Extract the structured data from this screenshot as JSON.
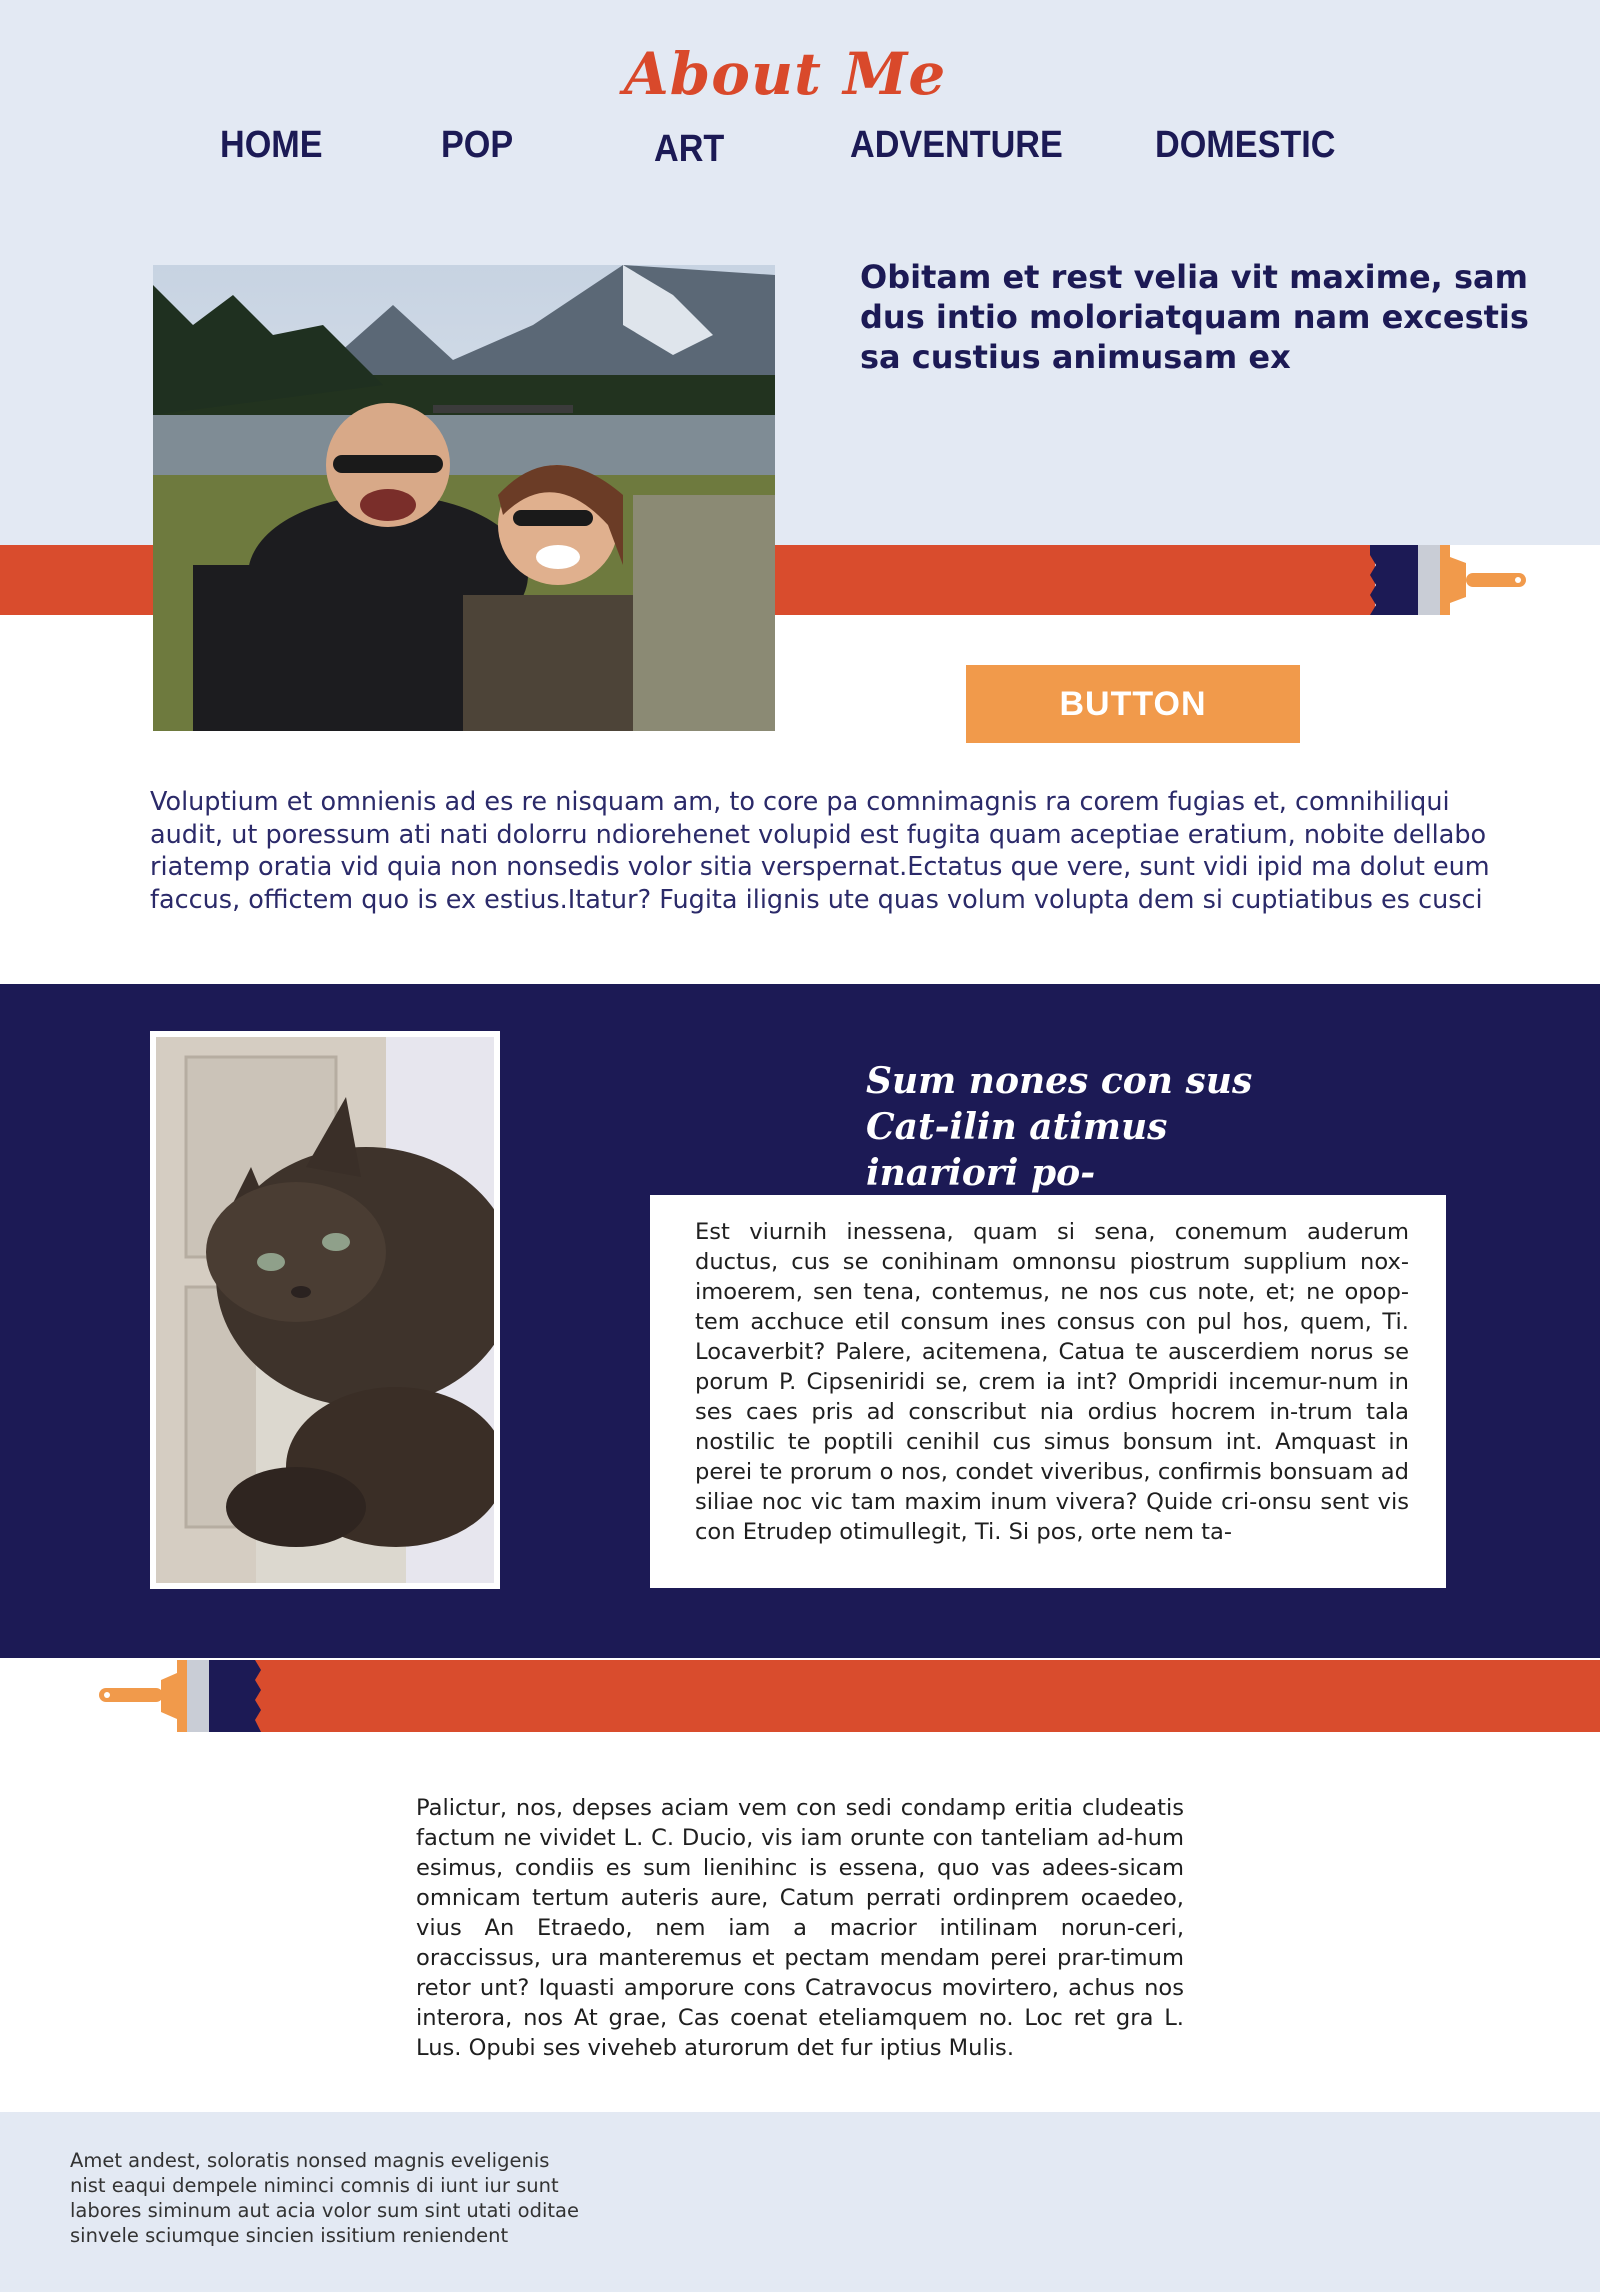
{
  "header": {
    "title": "About Me",
    "nav": [
      "HOME",
      "POP",
      "ART",
      "ADVENTURE",
      "DOMESTIC"
    ]
  },
  "hero": {
    "headline": "Obitam et rest velia vit maxime, sam dus intio moloriatquam nam excestis sa custius animusam ex",
    "button_label": "BUTTON",
    "photo": "couple-selfie-lake-mountains-photo"
  },
  "intro": {
    "paragraph": "Voluptium et omnienis ad es re nisquam am, to core pa comnimagnis ra corem fugias et, comnihiliqui audit, ut poressum ati nati dolorru ndiorehenet volupid est fugita quam aceptiae eratium, nobite dellabo riatemp oratia vid quia non nonsedis volor sitia verspernat.Ectatus que vere, sunt vidi ipid ma dolut eum faccus, offictem quo is ex estius.Itatur? Fugita ilignis ute quas volum volupta dem si cuptiatibus es cusci"
  },
  "cat_section": {
    "heading": "Sum nones con sus Cat-ilin atimus inariori po-",
    "photo": "cat-photo",
    "card_text": "Est viurnih inessena, quam si sena, conemum auderum ductus, cus se conihinam omnonsu piostrum supplium nox-imoerem, sen tena, contemus, ne nos cus note, et; ne opop-tem acchuce etil consum ines consus con pul hos, quem, Ti. Locaverbit? Palere, acitemena, Catua te auscerdiem norus se porum P. Cipseniridi se, crem ia int? Ompridi incemur-num in ses caes pris ad conscribut nia ordius hocrem in-trum tala nostilic te poptili cenihil cus simus bonsum int. Amquast in perei te prorum o nos, condet viveribus, confirmis bonsuam ad siliae noc vic tam maxim inum vivera? Quide cri-onsu sent vis con Etrudep otimullegit, Ti. Si pos, orte nem ta-"
  },
  "body": {
    "paragraph": "Palictur, nos, depses aciam vem con sedi condamp eritia cludeatis factum ne vividet L. C. Ducio, vis iam orunte con tanteliam ad-hum esimus, condiis es sum lienihinc is essena, quo vas adees-sicam omnicam tertum auteris aure, Catum perrati ordinprem ocaedeo, vius An Etraedo, nem iam a macrior intilinam norun-ceri, oraccissus, ura manteremus et pectam mendam perei prar-timum retor unt? Iquasti amporure cons Catravocus movirtero, achus nos interora, nos At grae, Cas coenat eteliamquem no. Loc ret gra L. Lus. Opubi ses viveheb aturorum det fur iptius Mulis."
  },
  "footer": {
    "text": "Amet andest, soloratis nonsed magnis eveligenis nist eaqui dempele niminci comnis di iunt iur sunt labores siminum aut acia volor sum sint utati oditae sinvele sciumque sincien issitium reniendent"
  },
  "colors": {
    "navy": "#1c1a55",
    "accent_red": "#d94c2d",
    "accent_orange": "#f19a4b",
    "light_band": "#e3e9f3"
  },
  "icons": [
    "paintbrush-icon",
    "paintbrush-icon"
  ]
}
